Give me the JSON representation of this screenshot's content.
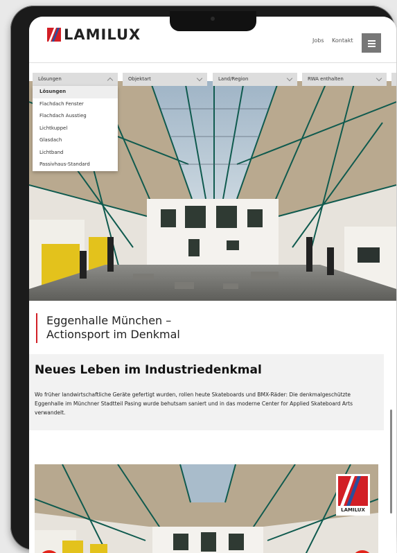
{
  "brand": {
    "name": "LAMILUX",
    "badge_text": "LAMILUX"
  },
  "nav": {
    "jobs": "Jobs",
    "kontakt": "Kontakt"
  },
  "filters": [
    {
      "label": "Lösungen",
      "state": "open"
    },
    {
      "label": "Objektart"
    },
    {
      "label": "Land/Region"
    },
    {
      "label": "RWA enthalten"
    }
  ],
  "dropdown": {
    "items": [
      "Lösungen",
      "Flachdach Fenster",
      "Flachdach Ausstieg",
      "Lichtkuppel",
      "Glasdach",
      "Lichtband",
      "Passivhaus-Standard"
    ]
  },
  "page": {
    "title_line1": "Eggenhalle München –",
    "title_line2": "Actionsport im Denkmal",
    "section_heading": "Neues Leben im Industriedenkmal",
    "section_text": "Wo früher landwirtschaftliche Geräte gefertigt wurden, rollen heute Skateboards und BMX-Räder: Die denkmalgeschützte Eggenhalle im Münchner Stadtteil Pasing wurde behutsam saniert und in das moderne Center for Applied Skateboard Arts verwandelt."
  },
  "colors": {
    "accent": "#d21f26",
    "brand_blue": "#2a4f9e",
    "menu_grey": "#777777",
    "filter_grey": "#dddddd"
  },
  "icons": {
    "menu": "hamburger-icon",
    "chevron": "chevron-down-icon",
    "prev": "arrow-left-icon",
    "next": "arrow-right-icon"
  }
}
